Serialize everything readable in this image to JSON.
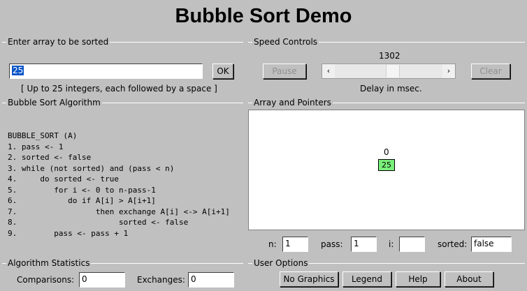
{
  "title": "Bubble Sort Demo",
  "input_box": {
    "legend": "Enter array to be sorted",
    "value": "25",
    "ok_label": "OK",
    "hint": "[ Up to 25 integers, each followed by a space ]"
  },
  "speed": {
    "legend": "Speed Controls",
    "delay_value": "1302",
    "pause_label": "Pause",
    "clear_label": "Clear",
    "caption": "Delay in msec.",
    "slider_level_fraction": 0.54
  },
  "algorithm": {
    "legend": "Bubble Sort Algorithm",
    "lines": [
      "BUBBLE_SORT (A)",
      "1. pass <- 1",
      "2. sorted <- false",
      "3. while (not sorted) and (pass < n)",
      "4.     do sorted <- true",
      "5.        for i <- 0 to n-pass-1",
      "6.           do if A[i] > A[i+1]",
      "7.                 then exchange A[i] <-> A[i+1]",
      "8.                      sorted <- false",
      "9.        pass <- pass + 1"
    ]
  },
  "array_panel": {
    "legend": "Array and Pointers",
    "index_label": "0",
    "cell_value": "25",
    "n_label": "n:",
    "n_value": "1",
    "pass_label": "pass:",
    "pass_value": "1",
    "i_label": "i:",
    "i_value": "",
    "sorted_label": "sorted:",
    "sorted_value": "false"
  },
  "stats": {
    "legend": "Algorithm Statistics",
    "comparisons_label": "Comparisons:",
    "comparisons_value": "0",
    "exchanges_label": "Exchanges:",
    "exchanges_value": "0"
  },
  "options": {
    "legend": "User Options",
    "no_graphics_label": "No Graphics",
    "legend_label": "Legend",
    "help_label": "Help",
    "about_label": "About"
  },
  "colors": {
    "background": "#c0c0c0",
    "cell_fill": "#7aef7a",
    "selection": "#0a56c8"
  }
}
